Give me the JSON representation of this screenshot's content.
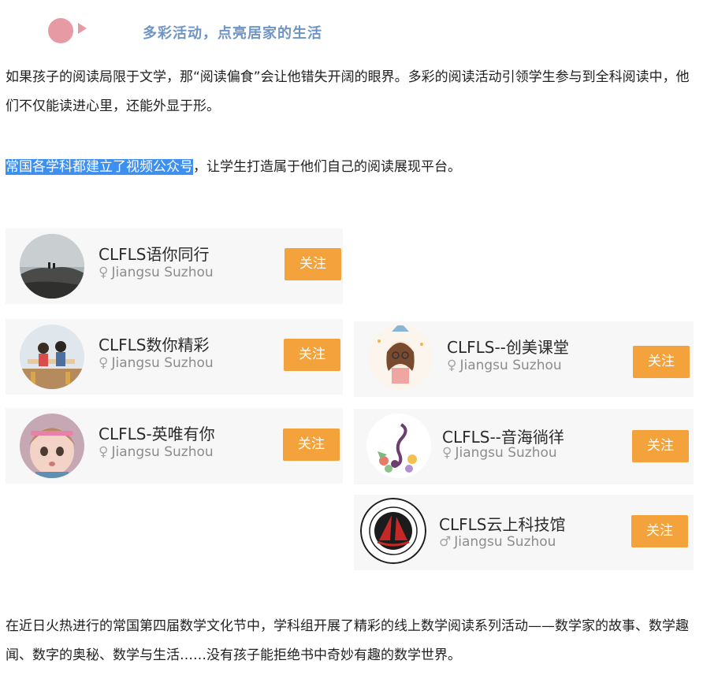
{
  "header": {
    "title": "多彩活动，点亮居家的生活"
  },
  "paragraphs": {
    "p1": "如果孩子的阅读局限于文学，那“阅读偏食”会让他错失开阔的眼界。多彩的阅读活动引领学生参与到全科阅读中，他们不仅能读进心里，还能外显于形。",
    "p2_highlight": "常国各学科都建立了视频公众号",
    "p2_rest": "，让学生打造属于他们自己的阅读展现平台。",
    "p3": "在近日火热进行的常国第四届数学文化节中，学科组开展了精彩的线上数学阅读系列活动——数学家的故事、数学趣闻、数字的奥秘、数学与生活……没有孩子能拒绝书中奇妙有趣的数学世界。"
  },
  "accounts": [
    {
      "name": "CLFLS语你同行",
      "gender_symbol": "♀",
      "location": "Jiangsu Suzhou",
      "follow_label": "关注",
      "avatar": "mountain-photo"
    },
    {
      "name": "CLFLS数你精彩",
      "gender_symbol": "♀",
      "location": "Jiangsu Suzhou",
      "follow_label": "关注",
      "avatar": "kids-photo"
    },
    {
      "name": "CLFLS-英唯有你",
      "gender_symbol": "♀",
      "location": "Jiangsu Suzhou",
      "follow_label": "关注",
      "avatar": "doll-photo"
    },
    {
      "name": "CLFLS--创美课堂",
      "gender_symbol": "♀",
      "location": "Jiangsu Suzhou",
      "follow_label": "关注",
      "avatar": "cartoon-girl"
    },
    {
      "name": "CLFLS--音海徜徉",
      "gender_symbol": "♀",
      "location": "Jiangsu Suzhou",
      "follow_label": "关注",
      "avatar": "music-note-flowers"
    },
    {
      "name": "CLFLS云上科技馆",
      "gender_symbol": "♂",
      "location": "Jiangsu Suzhou",
      "follow_label": "关注",
      "avatar": "school-seal"
    }
  ],
  "colors": {
    "accent": "#f4a23b",
    "highlight": "#3d8ff0",
    "header": "#6f95c6",
    "bullet": "#e59aa4"
  }
}
